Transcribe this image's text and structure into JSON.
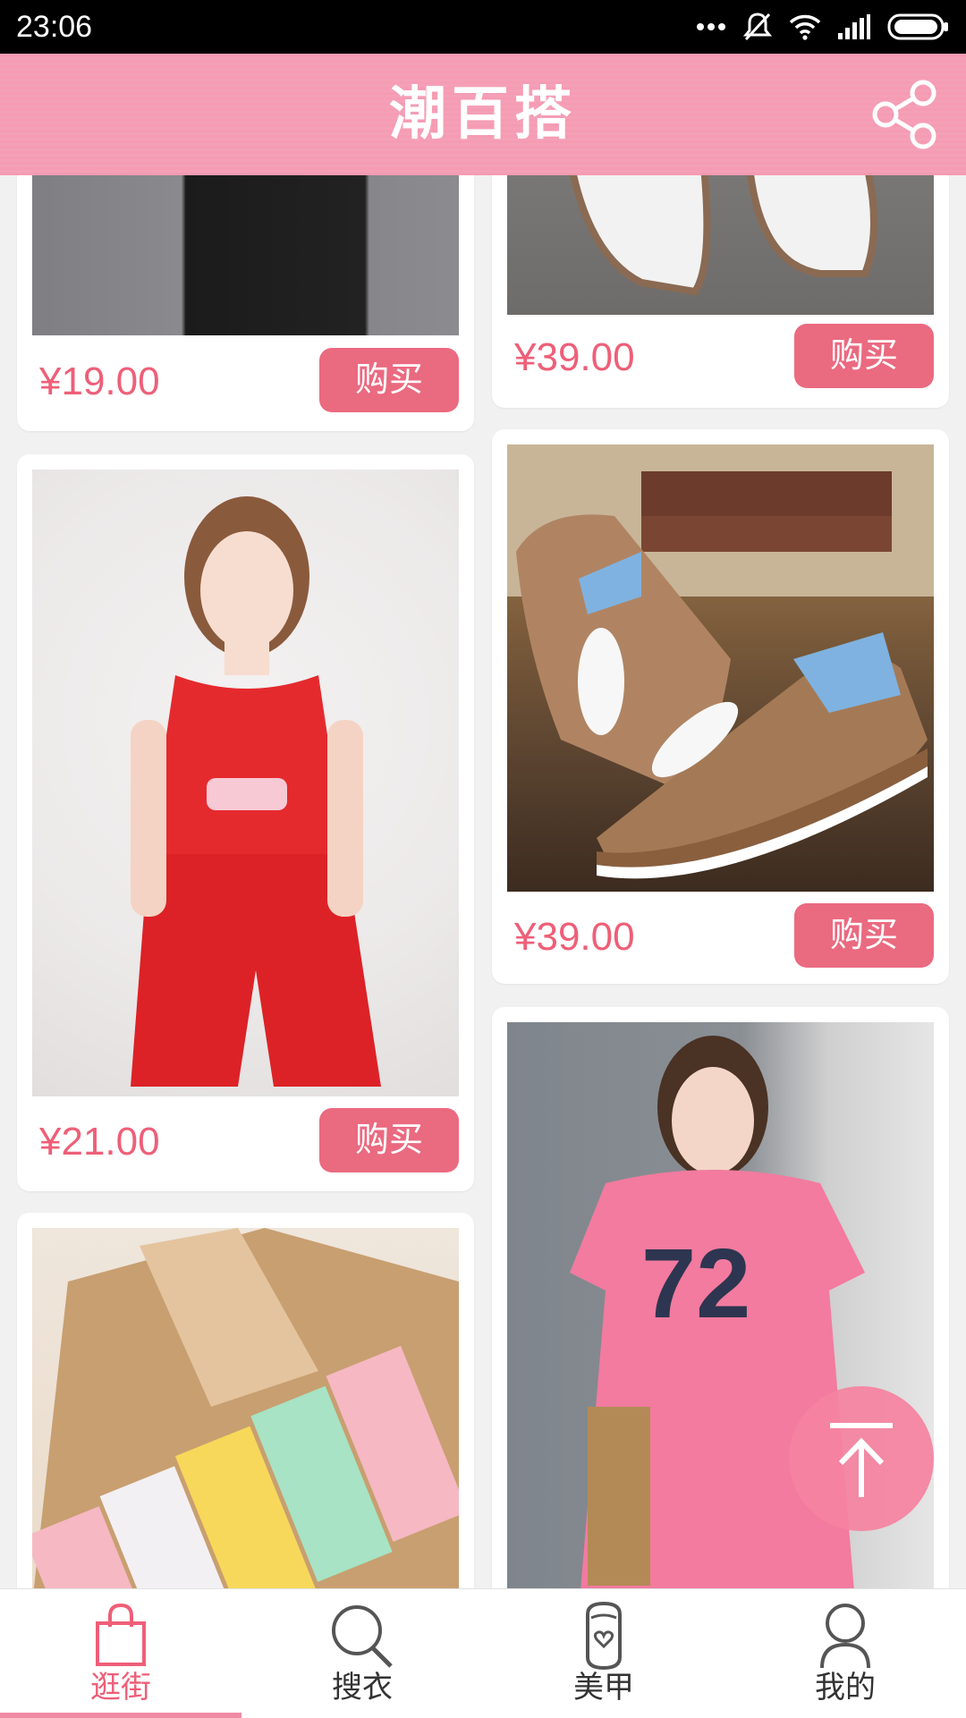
{
  "status_bar": {
    "time": "23:06",
    "icons": [
      "more-dots-icon",
      "silent-icon",
      "wifi-icon",
      "signal-icon",
      "battery-icon"
    ]
  },
  "header": {
    "title": "潮百搭",
    "share_icon": "share-icon"
  },
  "products": [
    {
      "price": "¥19.00",
      "buy_label": "购买",
      "image": "black dress"
    },
    {
      "price": "¥39.00",
      "buy_label": "购买",
      "image": "white sandals"
    },
    {
      "price": "¥21.00",
      "buy_label": "购买",
      "image": "red sleeveless romper"
    },
    {
      "price": "¥39.00",
      "buy_label": "购买",
      "image": "blue bunny flip-flop sandals"
    },
    {
      "price": "",
      "buy_label": "",
      "image": "striped socks box"
    },
    {
      "price": "",
      "buy_label": "",
      "image": "pink 72 t-shirt dress"
    }
  ],
  "back_to_top_icon": "arrow-up-to-top-icon",
  "bottom_nav": [
    {
      "label": "逛街",
      "icon": "shopping-bag-icon",
      "active": true
    },
    {
      "label": "搜衣",
      "icon": "search-icon",
      "active": false
    },
    {
      "label": "美甲",
      "icon": "nail-polish-icon",
      "active": false
    },
    {
      "label": "我的",
      "icon": "user-icon",
      "active": false
    }
  ],
  "colors": {
    "header": "#f59bb3",
    "accent": "#ee5f78",
    "buy_button": "#ea6a80",
    "fab": "#f582a0"
  }
}
